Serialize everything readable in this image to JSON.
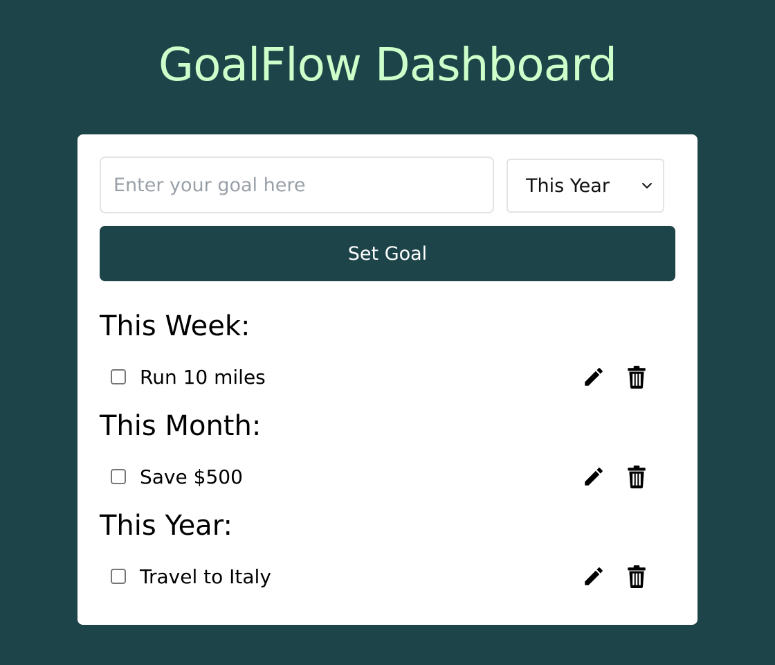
{
  "header": {
    "title": "GoalFlow Dashboard"
  },
  "form": {
    "goal_placeholder": "Enter your goal here",
    "goal_value": "",
    "period_selected": "This Year",
    "set_goal_label": "Set Goal"
  },
  "sections": [
    {
      "title": "This Week:",
      "goals": [
        {
          "text": "Run 10 miles",
          "done": false
        }
      ]
    },
    {
      "title": "This Month:",
      "goals": [
        {
          "text": "Save $500",
          "done": false
        }
      ]
    },
    {
      "title": "This Year:",
      "goals": [
        {
          "text": "Travel to Italy",
          "done": false
        }
      ]
    }
  ],
  "icons": {
    "edit": "pencil-icon",
    "delete": "trash-icon",
    "dropdown": "chevron-down-icon"
  },
  "colors": {
    "background": "#1d4449",
    "title": "#ccffc9",
    "card": "#ffffff",
    "button": "#1d4449",
    "button_text": "#ffffff"
  }
}
